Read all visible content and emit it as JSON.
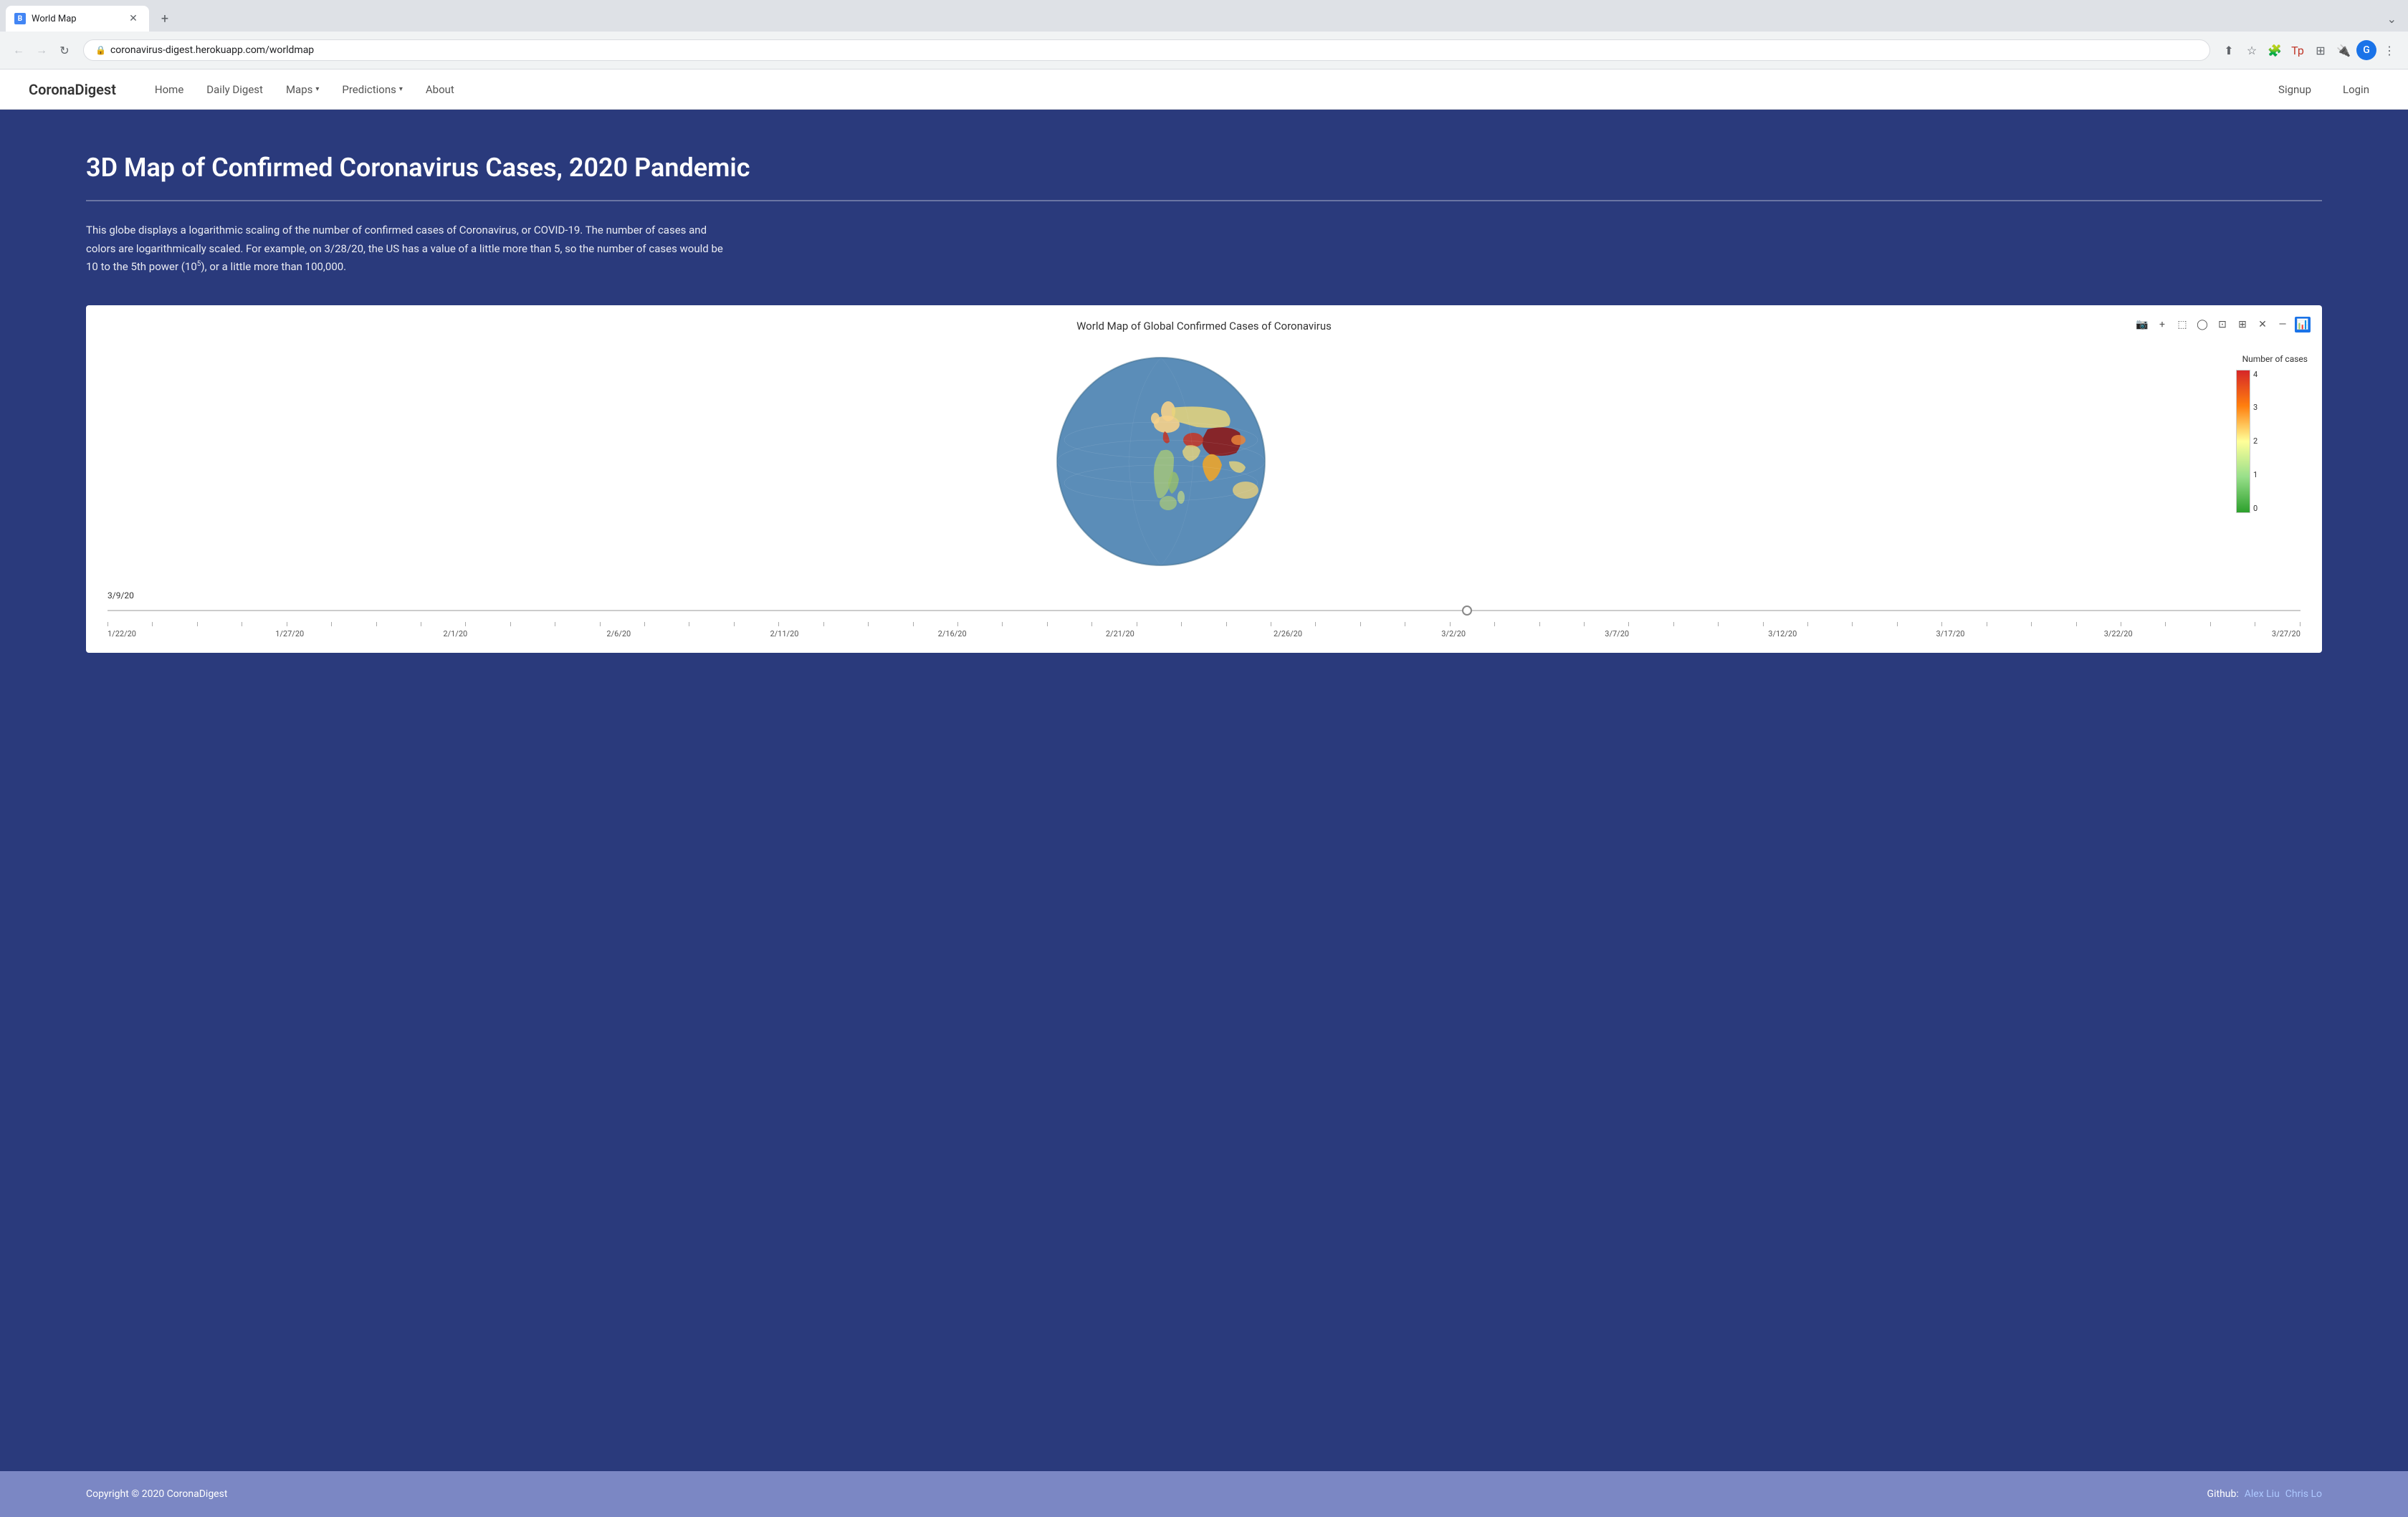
{
  "browser": {
    "tab_title": "World Map",
    "url": "coronavirus-digest.herokuapp.com/worldmap",
    "url_domain": "coronavirus-digest.herokuapp.com",
    "url_path": "/worldmap"
  },
  "navbar": {
    "brand": "CoronaDigest",
    "links": [
      {
        "label": "Home",
        "has_dropdown": false
      },
      {
        "label": "Daily Digest",
        "has_dropdown": false
      },
      {
        "label": "Maps",
        "has_dropdown": true
      },
      {
        "label": "Predictions",
        "has_dropdown": true
      },
      {
        "label": "About",
        "has_dropdown": false
      }
    ],
    "auth": {
      "signup": "Signup",
      "login": "Login"
    }
  },
  "page": {
    "title": "3D Map of Confirmed Coronavirus Cases, 2020 Pandemic",
    "description": "This globe displays a logarithmic scaling of the number of confirmed cases of Coronavirus, or COVID-19. The number of cases and colors are logarithmically scaled. For example, on 3/28/20, the US has a value of a little more than 5, so the number of cases would be 10 to the 5th power (10",
    "description_sup": "5",
    "description_end": "), or a little more than 100,000."
  },
  "chart": {
    "title": "World Map of Global Confirmed Cases of Coronavirus",
    "legend": {
      "title": "Number of cases",
      "scale_labels": [
        "4",
        "3",
        "2",
        "1",
        "0"
      ]
    },
    "timeline": {
      "current_date": "3/9/20",
      "dates": [
        "1/22/20",
        "1/27/20",
        "2/1/20",
        "2/6/20",
        "2/11/20",
        "2/16/20",
        "2/21/20",
        "2/26/20",
        "3/2/20",
        "3/7/20",
        "3/12/20",
        "3/17/20",
        "3/22/20",
        "3/27/20"
      ]
    }
  },
  "footer": {
    "copyright": "Copyright © 2020 CoronaDigest",
    "github_label": "Github:",
    "contributors": [
      {
        "name": "Alex Liu",
        "url": "#"
      },
      {
        "name": "Chris Lo",
        "url": "#"
      }
    ]
  },
  "icons": {
    "camera": "📷",
    "plus": "+",
    "lasso": "⬚",
    "speech": "💬",
    "crop": "⊡",
    "fullscreen": "⤢",
    "minus": "—",
    "chart": "📊"
  }
}
